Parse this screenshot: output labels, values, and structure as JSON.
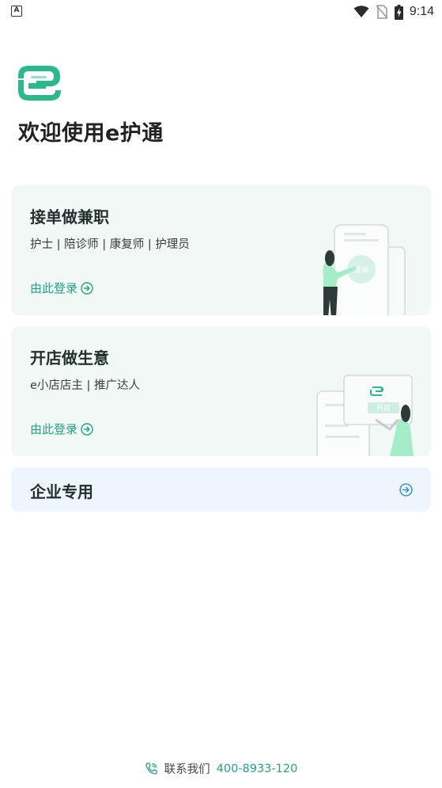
{
  "status_bar": {
    "app_letter": "A",
    "time": "9:14"
  },
  "header": {
    "welcome_text": "欢迎使用e护通"
  },
  "cards": [
    {
      "title": "接单做兼职",
      "subtitle": "护士 | 陪诊师 | 康复师 | 护理员",
      "link_label": "由此登录",
      "illustration_button": "接单"
    },
    {
      "title": "开店做生意",
      "subtitle": "e小店店主 | 推广达人",
      "link_label": "由此登录",
      "illustration_button": "开店"
    },
    {
      "title": "企业专用"
    }
  ],
  "footer": {
    "contact_label": "联系我们",
    "phone": "400-8933-120"
  },
  "colors": {
    "brand_green": "#1fa67e",
    "card_green_bg": "#f1f8f6",
    "card_blue_bg": "#eff5fd",
    "link_blue": "#2f8de4"
  },
  "icons": [
    "wifi-icon",
    "no-sim-icon",
    "battery-charging-icon",
    "arrow-circle-right-icon",
    "phone-icon"
  ]
}
